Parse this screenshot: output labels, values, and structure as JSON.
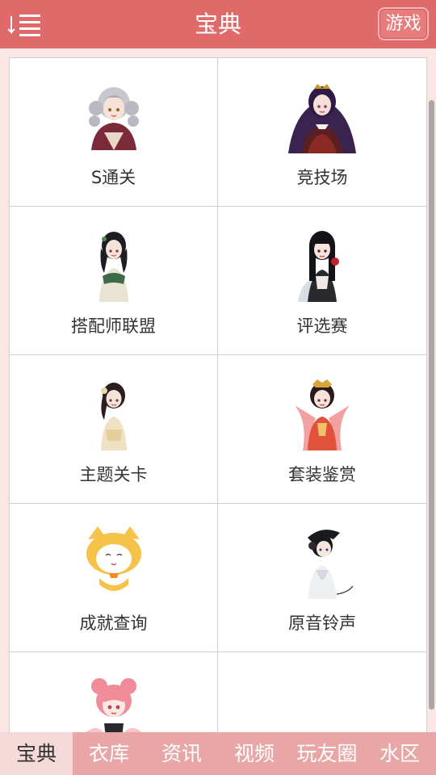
{
  "header": {
    "title": "宝典",
    "game_button": "游戏",
    "menu_icon": "menu-list-icon"
  },
  "grid": {
    "items": [
      {
        "label": "S通关",
        "icon": "character-silver-hair-icon"
      },
      {
        "label": "竞技场",
        "icon": "character-purple-crown-icon"
      },
      {
        "label": "搭配师联盟",
        "icon": "character-green-qipao-icon"
      },
      {
        "label": "评选赛",
        "icon": "character-black-hair-rose-icon"
      },
      {
        "label": "主题关卡",
        "icon": "character-gold-qipao-icon"
      },
      {
        "label": "套装鉴赏",
        "icon": "character-red-hanfu-icon"
      },
      {
        "label": "成就查询",
        "icon": "yellow-cat-mascot-icon"
      },
      {
        "label": "原音铃声",
        "icon": "character-headphones-icon"
      },
      {
        "label": "",
        "icon": "character-pink-hair-icon"
      },
      {
        "label": "",
        "icon": ""
      }
    ]
  },
  "tabs": [
    {
      "label": "宝典",
      "active": true
    },
    {
      "label": "衣库",
      "active": false
    },
    {
      "label": "资讯",
      "active": false
    },
    {
      "label": "视频",
      "active": false
    },
    {
      "label": "玩友圈",
      "active": false
    },
    {
      "label": "水区",
      "active": false
    }
  ],
  "colors": {
    "header_bg": "#e06a6a",
    "tabbar_bg": "#e8a6a6",
    "active_tab_bg": "#f6d9d9",
    "page_bg": "#fbe6e6"
  }
}
